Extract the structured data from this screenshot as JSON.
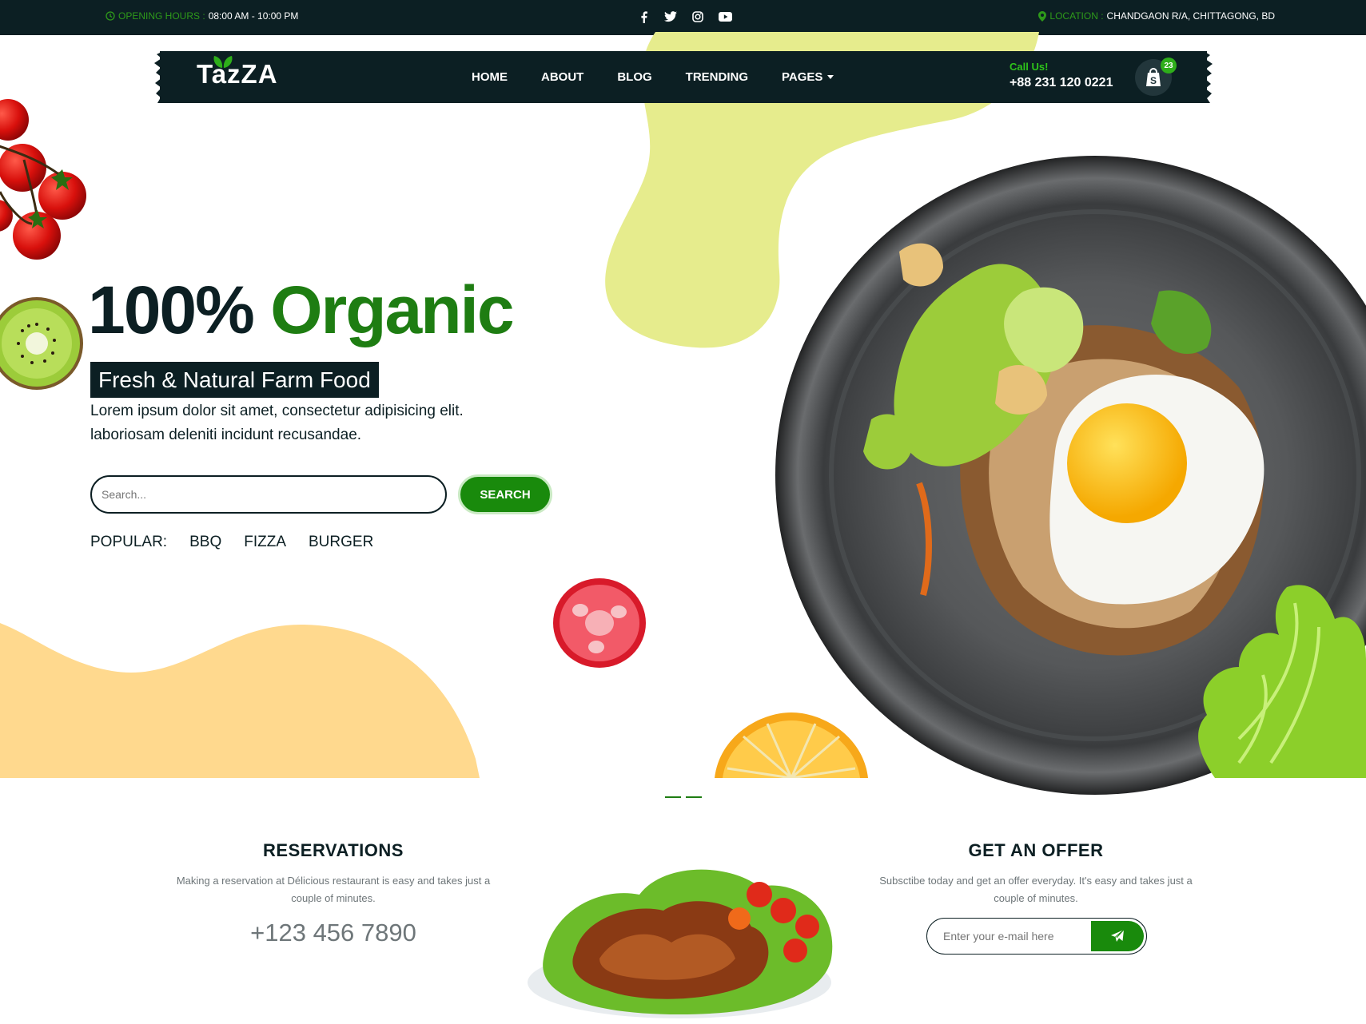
{
  "topbar": {
    "hours_label": "OPENING HOURS :",
    "hours_value": "08:00 AM - 10:00 PM",
    "location_label": "LOCATION :",
    "location_value": "CHANDGAON R/A, CHITTAGONG, BD",
    "social": [
      "facebook-icon",
      "twitter-icon",
      "instagram-icon",
      "youtube-icon"
    ]
  },
  "nav": {
    "logo": "TazZA",
    "items": [
      "HOME",
      "ABOUT",
      "BLOG",
      "TRENDING",
      "PAGES"
    ],
    "call_label": "Call Us!",
    "call_number": "+88 231 120 0221",
    "cart_count": "23"
  },
  "hero": {
    "title_dark": "100%",
    "title_green": "Organic",
    "tagline": "Fresh & Natural Farm Food",
    "description": "Lorem ipsum dolor sit amet, consectetur adipisicing elit. laboriosam deleniti incidunt recusandae.",
    "search_placeholder": "Search...",
    "search_button": "SEARCH",
    "popular_label": "POPULAR:",
    "popular_items": [
      "BBQ",
      "FIZZA",
      "BURGER"
    ]
  },
  "reservations": {
    "title": "RESERVATIONS",
    "text": "Making a reservation at Délicious restaurant is easy and takes just a couple of minutes.",
    "phone": "+123 456 7890"
  },
  "offer": {
    "title": "GET AN OFFER",
    "text": "Subsctibe today and get an offer everyday. It's easy and takes just a couple of minutes.",
    "email_placeholder": "Enter your e-mail here"
  },
  "colors": {
    "dark": "#0c1f23",
    "green": "#1e7d12",
    "accent_green": "#2e9a1a",
    "yellow_blob": "#e6ec8d",
    "orange_blob": "#ffd98e"
  }
}
